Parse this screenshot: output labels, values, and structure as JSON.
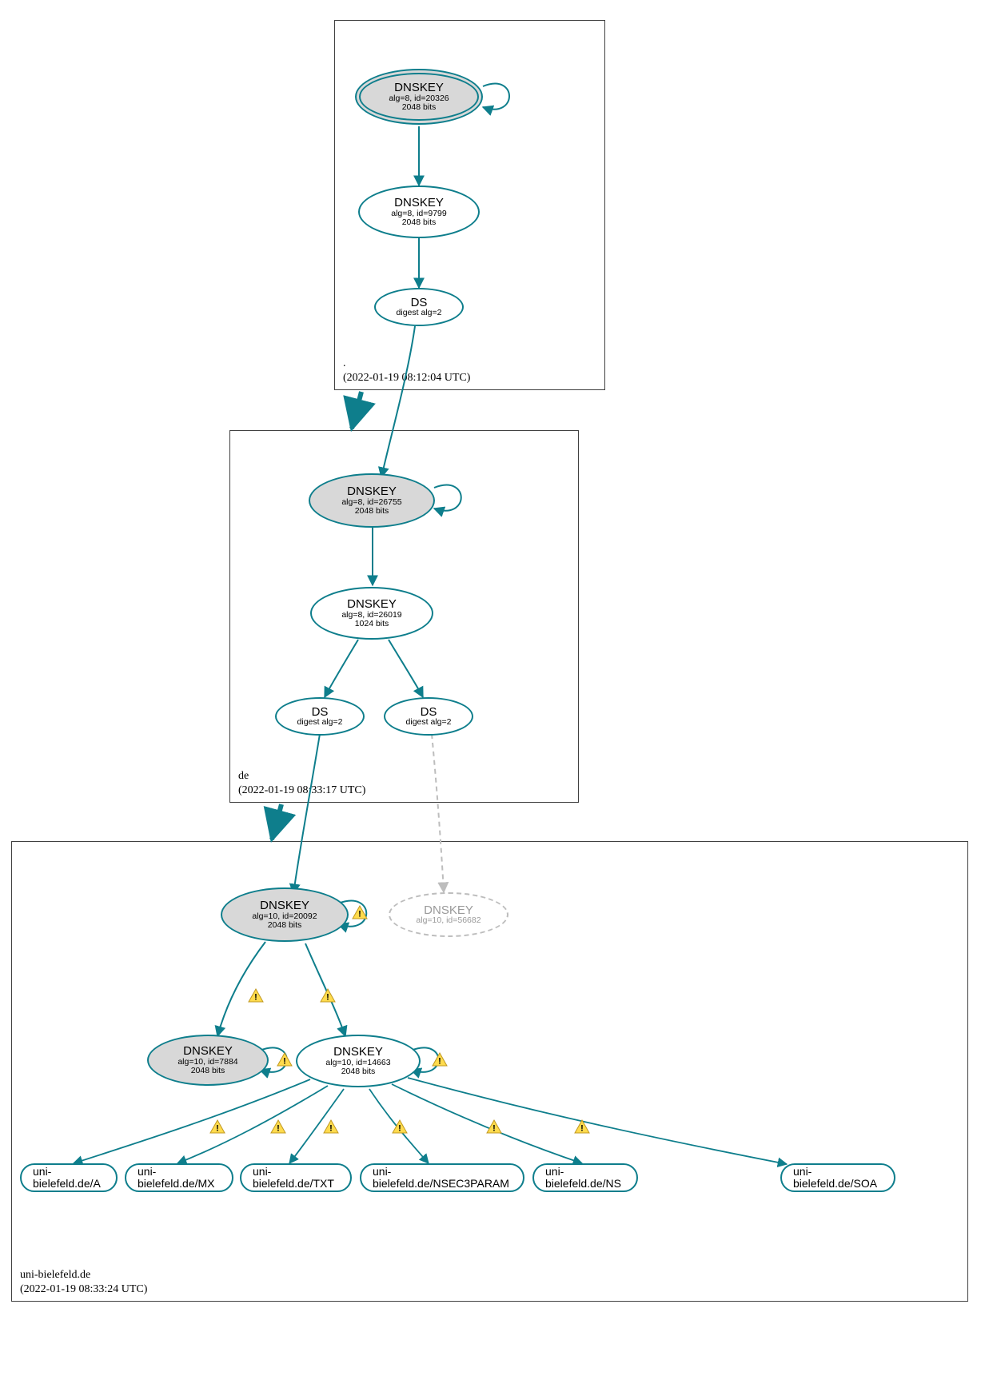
{
  "colors": {
    "accent": "#0e7e8c",
    "node_fill": "#d8d8d8",
    "dashed": "#bdbdbd",
    "warn_fill": "#ffdb4d",
    "warn_stroke": "#c09820"
  },
  "zones": {
    "root": {
      "name": ".",
      "timestamp": "(2022-01-19 08:12:04 UTC)"
    },
    "de": {
      "name": "de",
      "timestamp": "(2022-01-19 08:33:17 UTC)"
    },
    "domain": {
      "name": "uni-bielefeld.de",
      "timestamp": "(2022-01-19 08:33:24 UTC)"
    }
  },
  "nodes": {
    "root_ksk": {
      "title": "DNSKEY",
      "line2": "alg=8, id=20326",
      "line3": "2048 bits"
    },
    "root_zsk": {
      "title": "DNSKEY",
      "line2": "alg=8, id=9799",
      "line3": "2048 bits"
    },
    "root_ds": {
      "title": "DS",
      "line2": "digest alg=2"
    },
    "de_ksk": {
      "title": "DNSKEY",
      "line2": "alg=8, id=26755",
      "line3": "2048 bits"
    },
    "de_zsk": {
      "title": "DNSKEY",
      "line2": "alg=8, id=26019",
      "line3": "1024 bits"
    },
    "de_ds1": {
      "title": "DS",
      "line2": "digest alg=2"
    },
    "de_ds2": {
      "title": "DS",
      "line2": "digest alg=2"
    },
    "dom_ksk": {
      "title": "DNSKEY",
      "line2": "alg=10, id=20092",
      "line3": "2048 bits"
    },
    "dom_missing": {
      "title": "DNSKEY",
      "line2": "alg=10, id=56682"
    },
    "dom_k7884": {
      "title": "DNSKEY",
      "line2": "alg=10, id=7884",
      "line3": "2048 bits"
    },
    "dom_zsk": {
      "title": "DNSKEY",
      "line2": "alg=10, id=14663",
      "line3": "2048 bits"
    }
  },
  "records": {
    "a": "uni-bielefeld.de/A",
    "mx": "uni-bielefeld.de/MX",
    "txt": "uni-bielefeld.de/TXT",
    "nsec3param": "uni-bielefeld.de/NSEC3PARAM",
    "ns": "uni-bielefeld.de/NS",
    "soa": "uni-bielefeld.de/SOA"
  },
  "warn_glyph": "!"
}
